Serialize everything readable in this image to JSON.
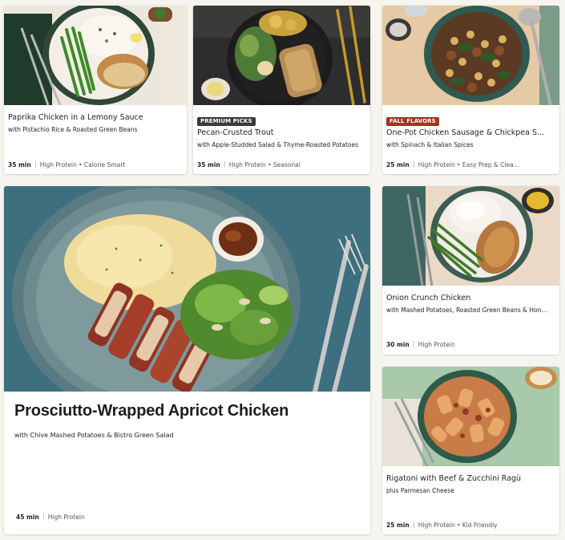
{
  "recipes": [
    {
      "title": "Paprika Chicken in a Lemony Sauce",
      "subtitle": "with Pistachio Rice & Roasted Green Beans",
      "time": "35 min",
      "tags": "High Protein • Calorie Smart",
      "image_alt": "paprika-chicken-plate"
    },
    {
      "badge": "PREMIUM PICKS",
      "title": "Pecan-Crusted Trout",
      "subtitle": "with Apple-Studded Salad & Thyme-Roasted Potatoes",
      "time": "35 min",
      "tags": "High Protein • Seasonal",
      "image_alt": "pecan-trout-plate"
    },
    {
      "badge": "FALL FLAVORS",
      "title": "One-Pot Chicken Sausage & Chickpea S...",
      "subtitle": "with Spinach & Italian Spices",
      "time": "25 min",
      "tags": "High Protein • Easy Prep & Clea...",
      "image_alt": "chickpea-stew-pot"
    },
    {
      "title": "Prosciutto-Wrapped Apricot Chicken",
      "subtitle": "with Chive Mashed Potatoes & Bistro Green Salad",
      "time": "45 min",
      "tags": "High Protein",
      "image_alt": "prosciutto-chicken-plate"
    },
    {
      "title": "Onion Crunch Chicken",
      "subtitle": "with Mashed Potatoes, Roasted Green Beans & Hon...",
      "time": "30 min",
      "tags": "High Protein",
      "image_alt": "onion-crunch-chicken-plate"
    },
    {
      "title": "Rigatoni with Beef & Zucchini Ragù",
      "subtitle": "plus Parmesan Cheese",
      "time": "25 min",
      "tags": "High Protein • Kid Friendly",
      "image_alt": "rigatoni-ragu-bowl"
    }
  ],
  "colors": {
    "page_bg": "#f5f4ef",
    "card_bg": "#ffffff",
    "badge_premium": "#3a3a3a",
    "badge_fall": "#a4331f"
  }
}
